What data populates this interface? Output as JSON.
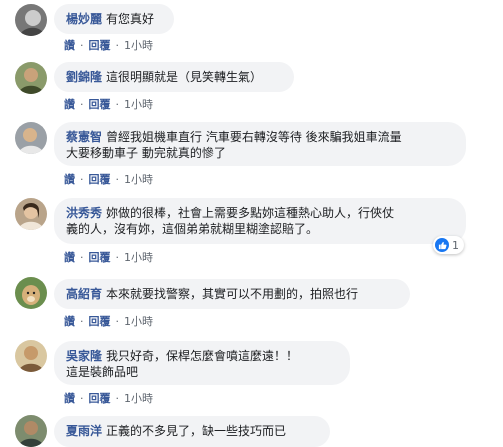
{
  "actions": {
    "like": "讚",
    "reply": "回覆",
    "separator": "·"
  },
  "comments": [
    {
      "name": "楊妙麗",
      "text": "有您真好",
      "time": "1小時"
    },
    {
      "name": "劉錦隆",
      "text": "這很明顯就是（見笑轉生氣）",
      "time": "1小時"
    },
    {
      "name": "蔡憲智",
      "text": "曾經我姐機車直行 汽車要右轉沒等待 後來騙我姐車流量",
      "text2": "大要移動車子 動完就真的慘了",
      "time": "1小時"
    },
    {
      "name": "洪秀秀",
      "text": "妳做的很棒，社會上需要多點妳這種熱心助人，行俠仗",
      "text2": "義的人，沒有妳，這個弟弟就糊里糊塗認賠了。",
      "time": "1小時",
      "reactions": "1"
    },
    {
      "name": "高紹育",
      "text": "本來就要找警察，其實可以不用劃的，拍照也行",
      "time": "1小時"
    },
    {
      "name": "吳家隆",
      "text": "我只好奇，保桿怎麼會噴這麼遠！！",
      "text2": "這是裝飾品吧",
      "time": "1小時"
    },
    {
      "name": "夏雨洋",
      "text": "正義的不多見了，缺一些技巧而已",
      "time": ""
    }
  ],
  "colors": {
    "name": "#385898",
    "bubble": "#f2f3f5",
    "meta": "#606770",
    "like": "#1877f2"
  }
}
